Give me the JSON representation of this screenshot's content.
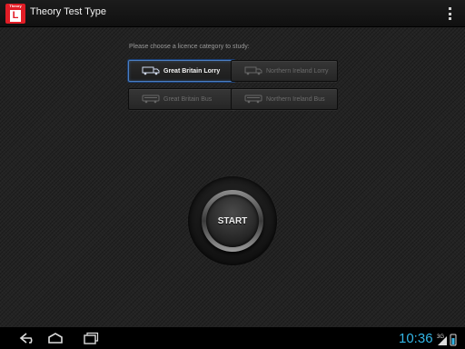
{
  "app": {
    "icon_top_text": "Theory",
    "icon_letter": "L",
    "title": "Theory Test Type"
  },
  "main": {
    "prompt": "Please choose a licence category to study:",
    "categories": [
      {
        "label": "Great Britain Lorry",
        "icon": "lorry-icon",
        "selected": true
      },
      {
        "label": "Northern Ireland Lorry",
        "icon": "lorry-icon",
        "selected": false
      },
      {
        "label": "Great Britain Bus",
        "icon": "bus-icon",
        "selected": false
      },
      {
        "label": "Northern Ireland Bus",
        "icon": "bus-icon",
        "selected": false
      }
    ],
    "start_label": "START"
  },
  "status": {
    "time": "10:36",
    "network": "3G"
  },
  "colors": {
    "accent": "#4c7fc2",
    "clock": "#33b5e5",
    "brand": "#e11d26"
  }
}
